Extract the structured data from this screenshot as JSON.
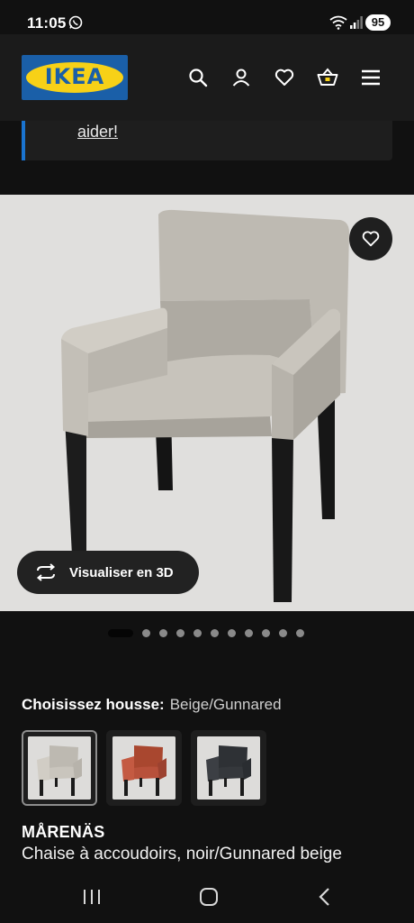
{
  "status_bar": {
    "time": "11:05",
    "battery": "95",
    "icons": [
      "whatsapp-icon",
      "wifi-icon",
      "signal-icon"
    ]
  },
  "header": {
    "logo_text": "IKEA",
    "icons": [
      "search-icon",
      "user-icon",
      "heart-icon",
      "basket-icon",
      "menu-icon"
    ]
  },
  "help_card": {
    "link_text": "aider!"
  },
  "product_image": {
    "view_3d_label": "Visualiser en 3D",
    "carousel_total": 12,
    "carousel_active": 1
  },
  "cover": {
    "label": "Choisissez housse:",
    "selected_value": "Beige/Gunnared",
    "options": [
      {
        "name": "beige",
        "color": "#c9c5bd"
      },
      {
        "name": "red",
        "color": "#b8513b"
      },
      {
        "name": "dark-grey",
        "color": "#35383c"
      }
    ]
  },
  "product": {
    "name": "MÅRENÄS",
    "description": "Chaise à accoudoirs, noir/Gunnared beige"
  },
  "colors": {
    "ikea_blue": "#1a5fa8",
    "ikea_yellow": "#f7d117",
    "accent_blue": "#1a74d0"
  },
  "nav_bar": {
    "icons": [
      "recent-apps-icon",
      "home-icon",
      "back-icon"
    ]
  }
}
